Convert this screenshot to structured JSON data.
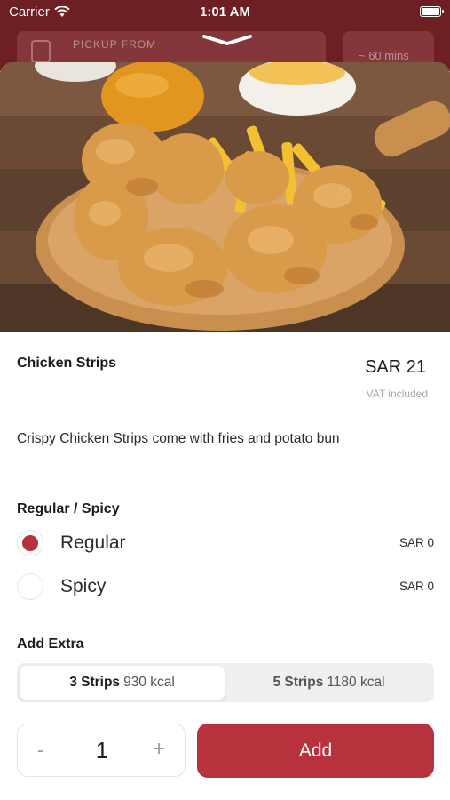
{
  "status_bar": {
    "carrier": "Carrier",
    "time": "1:01 AM"
  },
  "header": {
    "pickup_label": "PICKUP FROM",
    "eta": "~ 60 mins"
  },
  "product": {
    "title": "Chicken Strips",
    "price": "SAR 21",
    "vat_note": "VAT included",
    "description": "Crispy Chicken Strips come with fries and potato bun"
  },
  "options": {
    "title": "Regular / Spicy",
    "items": [
      {
        "label": "Regular",
        "price": "SAR 0",
        "selected": true
      },
      {
        "label": "Spicy",
        "price": "SAR 0",
        "selected": false
      }
    ]
  },
  "extras": {
    "title": "Add Extra",
    "segments": [
      {
        "label": "3 Strips",
        "kcal": "930 kcal",
        "selected": true
      },
      {
        "label": "5 Strips",
        "kcal": "1180 kcal",
        "selected": false
      }
    ]
  },
  "cart": {
    "minus": "-",
    "quantity": "1",
    "plus": "+",
    "add_label": "Add"
  },
  "colors": {
    "header_bg": "#6e1f24",
    "accent": "#b7323c"
  }
}
